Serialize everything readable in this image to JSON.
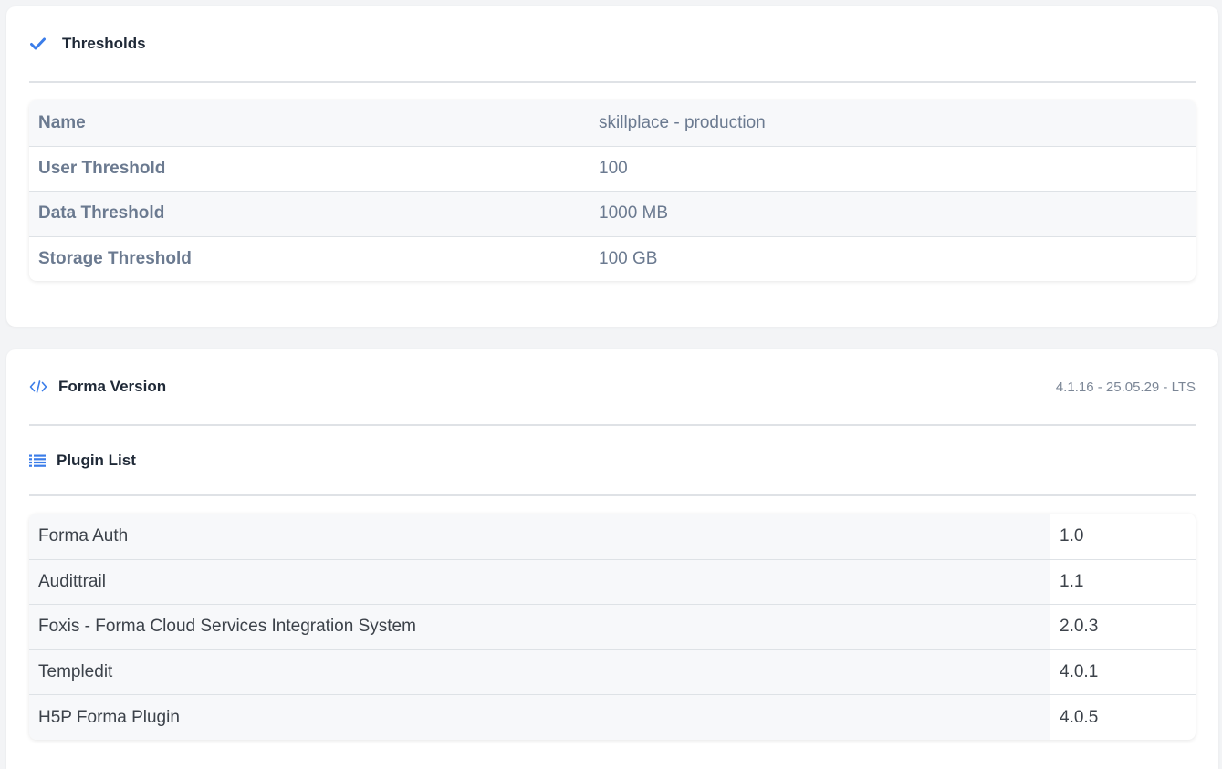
{
  "thresholds": {
    "title": "Thresholds",
    "icon": "check-icon",
    "rows": [
      {
        "label": "Name",
        "value": "skillplace - production"
      },
      {
        "label": "User Threshold",
        "value": "100"
      },
      {
        "label": "Data Threshold",
        "value": "1000 MB"
      },
      {
        "label": "Storage Threshold",
        "value": "100 GB"
      }
    ]
  },
  "forma_version": {
    "title": "Forma Version",
    "icon": "code-icon",
    "version": "4.1.16 - 25.05.29 - LTS"
  },
  "plugin_list": {
    "title": "Plugin List",
    "icon": "list-icon",
    "plugins": [
      {
        "name": "Forma Auth",
        "version": "1.0"
      },
      {
        "name": "Audittrail",
        "version": "1.1"
      },
      {
        "name": "Foxis - Forma Cloud Services Integration System",
        "version": "2.0.3"
      },
      {
        "name": "Templedit",
        "version": "4.0.1"
      },
      {
        "name": "H5P Forma Plugin",
        "version": "4.0.5"
      }
    ]
  },
  "colors": {
    "accent": "#3b7de9",
    "muted_text": "#6b7a90",
    "dark_text": "#1f2937"
  }
}
